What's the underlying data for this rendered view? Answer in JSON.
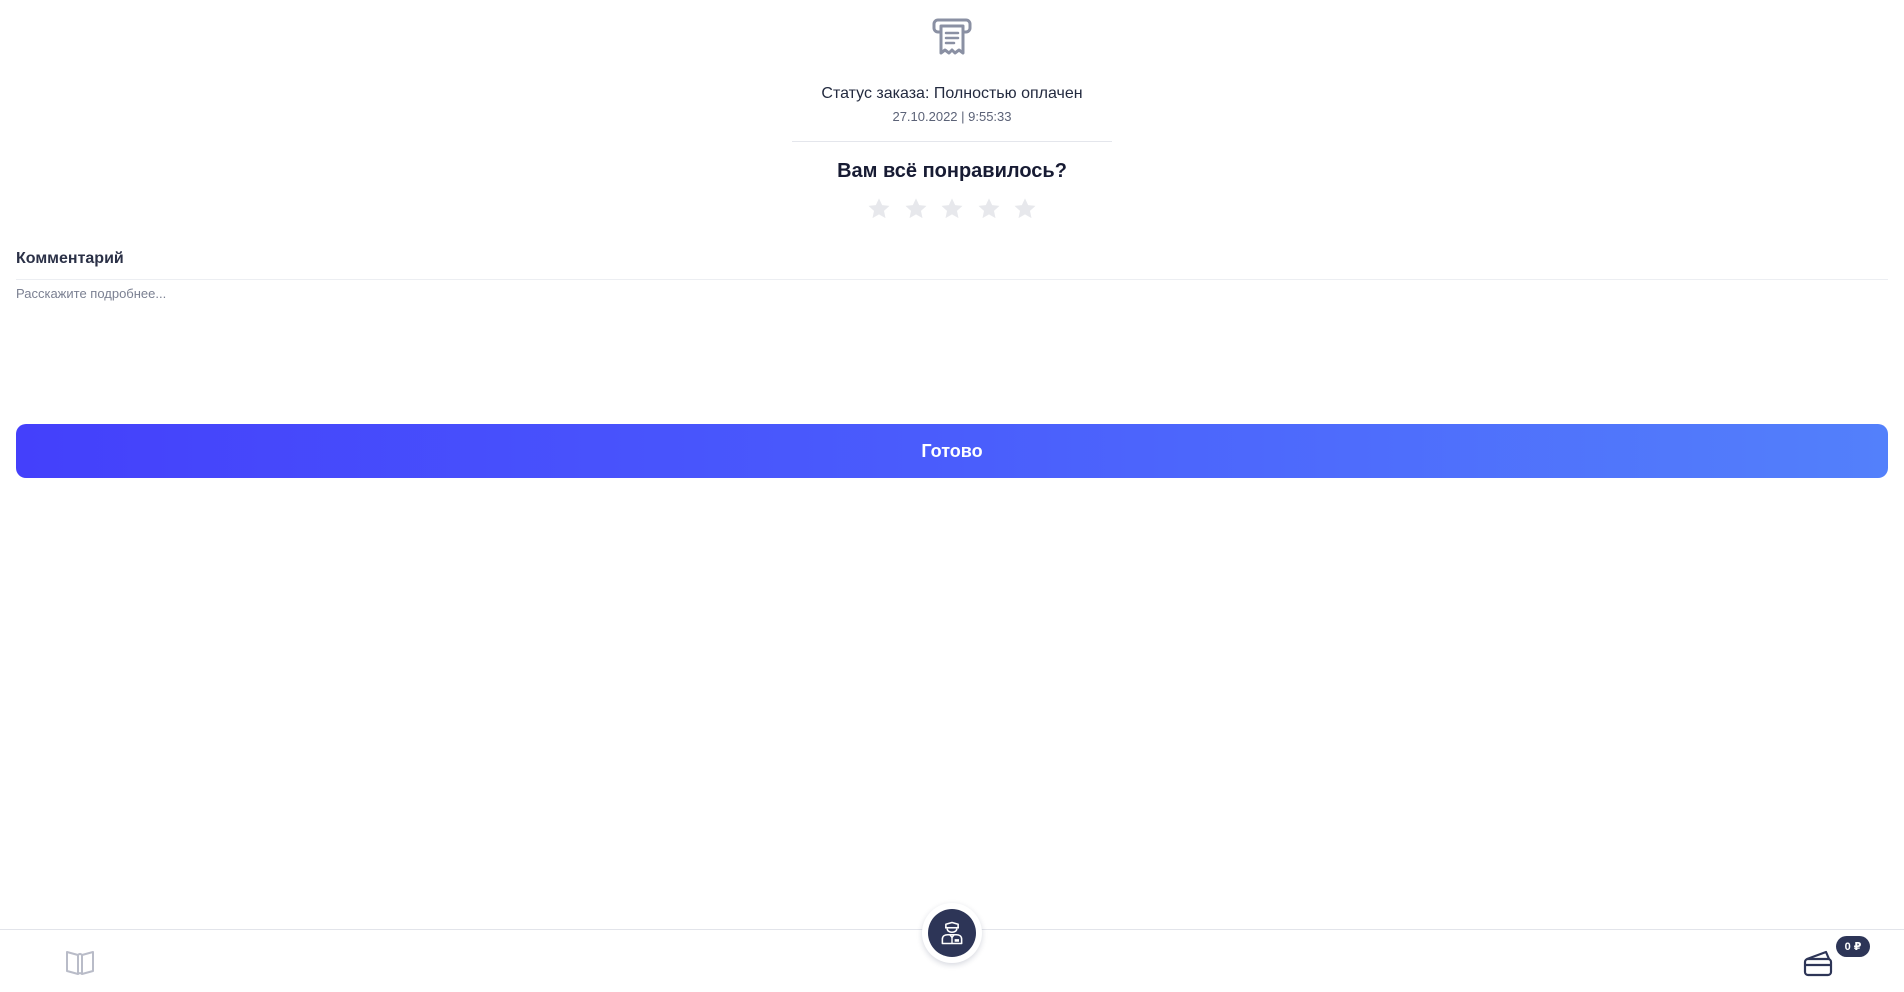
{
  "order": {
    "status_text": "Статус заказа: Полностью оплачен",
    "datetime": "27.10.2022 | 9:55:33"
  },
  "rating": {
    "question": "Вам всё понравилось?",
    "stars_total": 5,
    "stars_selected": 0
  },
  "comment": {
    "label": "Комментарий",
    "placeholder": "Расскажите подробнее...",
    "value": ""
  },
  "actions": {
    "done_label": "Готово"
  },
  "bottom_nav": {
    "menu_icon": "book-open-icon",
    "waiter_icon": "waiter-icon",
    "wallet_icon": "wallet-icon",
    "balance": "0 ₽"
  },
  "colors": {
    "button_gradient_start": "#4440fb",
    "button_gradient_end": "#5380fb",
    "dark_accent": "#2d3557",
    "star_empty": "#e7e8ec"
  }
}
